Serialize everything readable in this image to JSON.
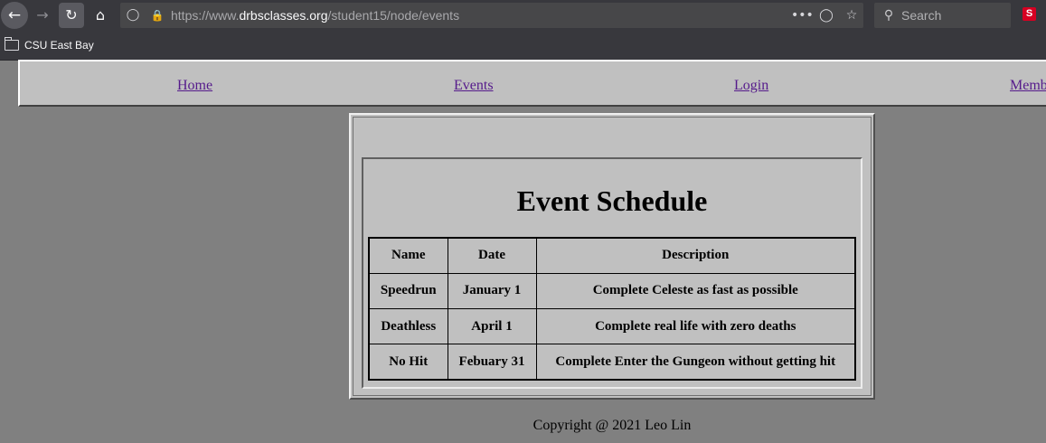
{
  "browser": {
    "url_prefix": "https://www.",
    "url_host": "drbsclasses.org",
    "url_path": "/student15/node/events",
    "search_placeholder": "Search",
    "extension_badge": "S",
    "bookmarks": [
      {
        "label": "CSU East Bay"
      }
    ]
  },
  "nav": {
    "items": [
      {
        "label": "Home"
      },
      {
        "label": "Events"
      },
      {
        "label": "Login"
      },
      {
        "label": "Memb"
      }
    ]
  },
  "main": {
    "title": "Event Schedule",
    "table": {
      "headers": [
        "Name",
        "Date",
        "Description"
      ],
      "rows": [
        [
          "Speedrun",
          "January 1",
          "Complete Celeste as fast as possible"
        ],
        [
          "Deathless",
          "April 1",
          "Complete real life with zero deaths"
        ],
        [
          "No Hit",
          "Febuary 31",
          "Complete Enter the Gungeon without getting hit"
        ]
      ]
    }
  },
  "footer": {
    "text": "Copyright @ 2021 Leo Lin"
  }
}
